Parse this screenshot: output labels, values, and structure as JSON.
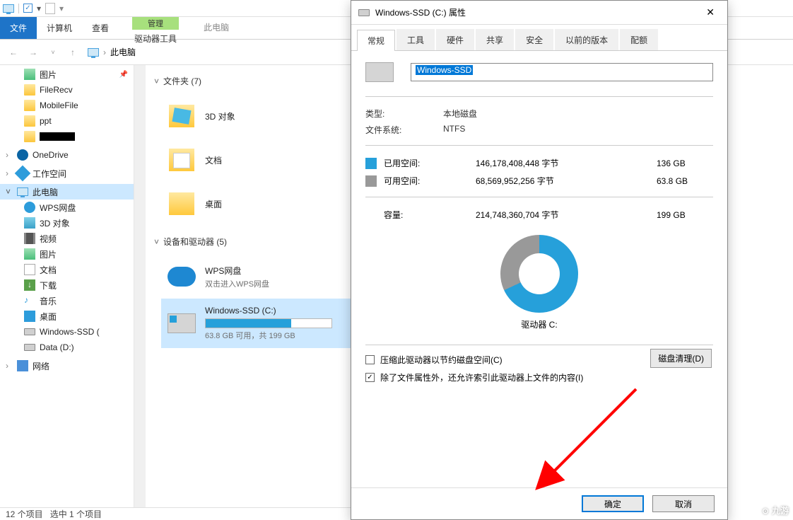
{
  "ribbon": {
    "file": "文件",
    "computer": "计算机",
    "view": "查看",
    "manage": "管理",
    "drive_tools": "驱动器工具",
    "thispc": "此电脑"
  },
  "breadcrumb": {
    "root": "此电脑"
  },
  "sidebar": {
    "items": [
      {
        "label": "图片"
      },
      {
        "label": "FileRecv"
      },
      {
        "label": "MobileFile"
      },
      {
        "label": "ppt"
      },
      {
        "label": ""
      }
    ],
    "onedrive": "OneDrive",
    "workspace": "工作空间",
    "thispc": "此电脑",
    "wps": "WPS网盘",
    "objects3d": "3D 对象",
    "video": "视频",
    "pictures": "图片",
    "docs": "文档",
    "downloads": "下载",
    "music": "音乐",
    "desktop": "桌面",
    "ssd": "Windows-SSD (",
    "data": "Data (D:)",
    "network": "网络"
  },
  "content": {
    "group_folders": "文件夹 (7)",
    "group_devices": "设备和驱动器 (5)",
    "folders": [
      {
        "label": "3D 对象"
      },
      {
        "label": "文档"
      },
      {
        "label": "桌面"
      }
    ],
    "devices": [
      {
        "label": "WPS网盘",
        "sub": "双击进入WPS网盘"
      },
      {
        "label": "Windows-SSD (C:)",
        "sub": "63.8 GB 可用，共 199 GB",
        "fill": 68
      }
    ]
  },
  "status": {
    "count": "12 个项目",
    "sel": "选中 1 个项目"
  },
  "dialog": {
    "title": "Windows-SSD (C:) 属性",
    "tabs": [
      "常规",
      "工具",
      "硬件",
      "共享",
      "安全",
      "以前的版本",
      "配额"
    ],
    "volume_name": "Windows-SSD",
    "type_k": "类型:",
    "type_v": "本地磁盘",
    "fs_k": "文件系统:",
    "fs_v": "NTFS",
    "used_k": "已用空间:",
    "used_bytes": "146,178,408,448 字节",
    "used_gb": "136 GB",
    "free_k": "可用空间:",
    "free_bytes": "68,569,952,256 字节",
    "free_gb": "63.8 GB",
    "cap_k": "容量:",
    "cap_bytes": "214,748,360,704 字节",
    "cap_gb": "199 GB",
    "drive_under": "驱动器 C:",
    "cleanup": "磁盘清理(D)",
    "compress": "压缩此驱动器以节约磁盘空间(C)",
    "index": "除了文件属性外，还允许索引此驱动器上文件的内容(I)",
    "ok": "确定",
    "cancel": "取消"
  },
  "colors": {
    "accent": "#26a0da",
    "sel": "#cce8ff"
  },
  "watermark": "九游"
}
